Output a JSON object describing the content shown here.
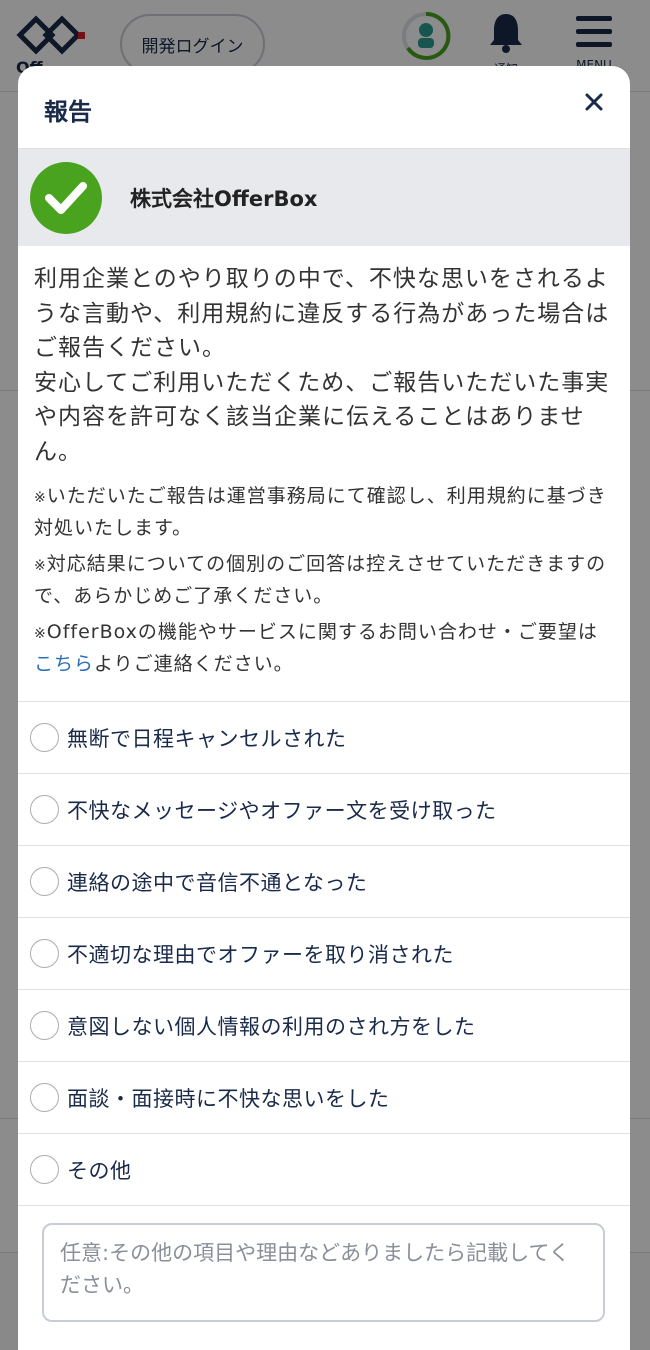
{
  "background": {
    "logo_text": "Off...",
    "login_button": "開発ログイン",
    "notification_label": "通知",
    "menu_label": "MENU",
    "profile_percent": "85%"
  },
  "modal": {
    "title": "報告",
    "company_name": "株式会社OfferBox",
    "description": "利用企業とのやり取りの中で、不快な思いをされるような言動や、利用規約に違反する行為があった場合はご報告ください。\n安心してご利用いただくため、ご報告いただいた事実や内容を許可なく該当企業に伝えることはありません。",
    "notes": [
      {
        "mark": "※",
        "text": "いただいたご報告は運営事務局にて確認し、利用規約に基づき対処いたします。"
      },
      {
        "mark": "※",
        "text": "対応結果についての個別のご回答は控えさせていただきますので、あらかじめご了承ください。"
      }
    ],
    "note3": {
      "mark": "※",
      "before": "OfferBoxの機能やサービスに関するお問い合わせ・ご要望は",
      "link": "こちら",
      "after": "よりご連絡ください。"
    },
    "options": [
      "無断で日程キャンセルされた",
      "不快なメッセージやオファー文を受け取った",
      "連絡の途中で音信不通となった",
      "不適切な理由でオファーを取り消された",
      "意図しない個人情報の利用のされ方をした",
      "面談・面接時に不快な思いをした",
      "その他"
    ],
    "textarea_placeholder": "任意:その他の項目や理由などありましたら記載してください。"
  },
  "colors": {
    "check_green": "#4aa31e",
    "navy": "#1a2a4a",
    "link_blue": "#2a6fb6"
  }
}
